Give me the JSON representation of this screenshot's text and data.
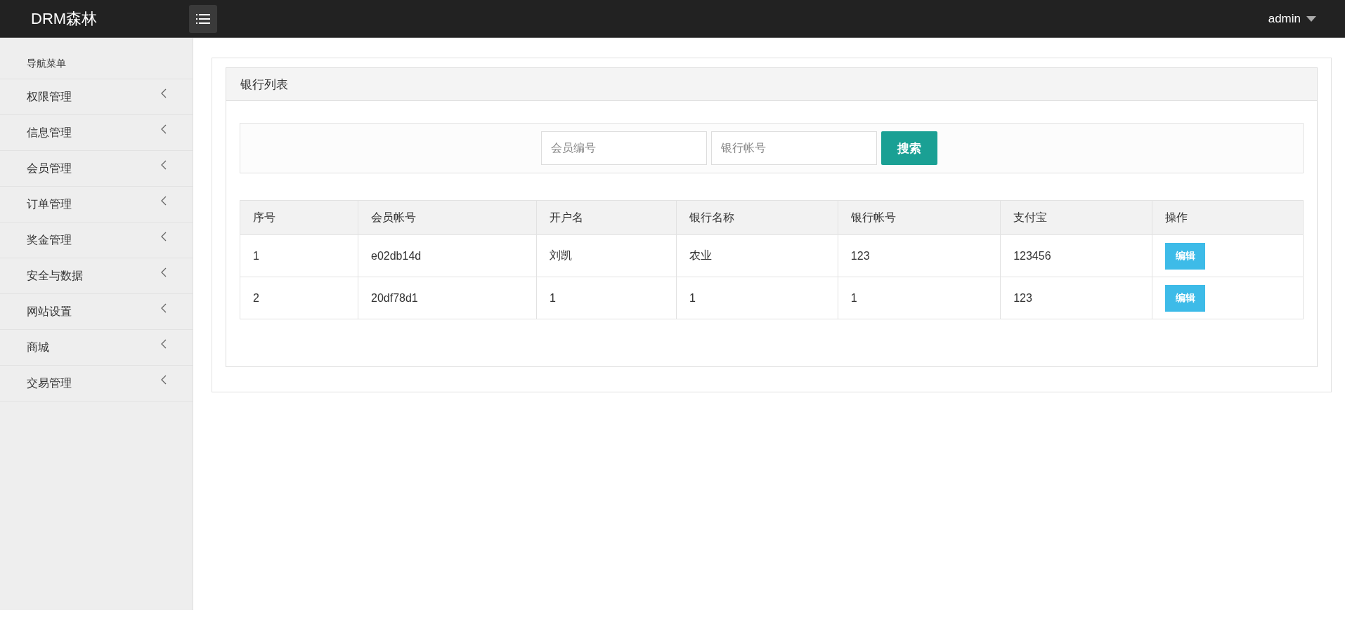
{
  "topbar": {
    "brand": "DRM森林",
    "user": "admin"
  },
  "sidebar": {
    "heading": "导航菜单",
    "items": [
      {
        "label": "权限管理",
        "expanded": false
      },
      {
        "label": "信息管理",
        "expanded": false
      },
      {
        "label": "会员管理",
        "expanded": false
      },
      {
        "label": "订单管理",
        "expanded": false
      },
      {
        "label": "奖金管理",
        "expanded": false
      },
      {
        "label": "安全与数据",
        "expanded": false
      },
      {
        "label": "网站设置",
        "expanded": false
      },
      {
        "label": "商城",
        "expanded": false
      },
      {
        "label": "交易管理",
        "expanded": false
      }
    ]
  },
  "panel": {
    "title": "银行列表",
    "search": {
      "fields": [
        {
          "placeholder": "会员编号"
        },
        {
          "placeholder": "银行帐号"
        }
      ],
      "button": "搜索"
    },
    "table": {
      "columns": [
        "序号",
        "会员帐号",
        "开户名",
        "银行名称",
        "银行帐号",
        "支付宝",
        "操作"
      ],
      "rows": [
        {
          "cells": [
            "1",
            "e02db14d",
            "刘凯",
            "农业",
            "123",
            "123456"
          ],
          "action": "编辑"
        },
        {
          "cells": [
            "2",
            "20df78d1",
            "1",
            "1",
            "1",
            "123"
          ],
          "action": "编辑"
        }
      ]
    }
  }
}
